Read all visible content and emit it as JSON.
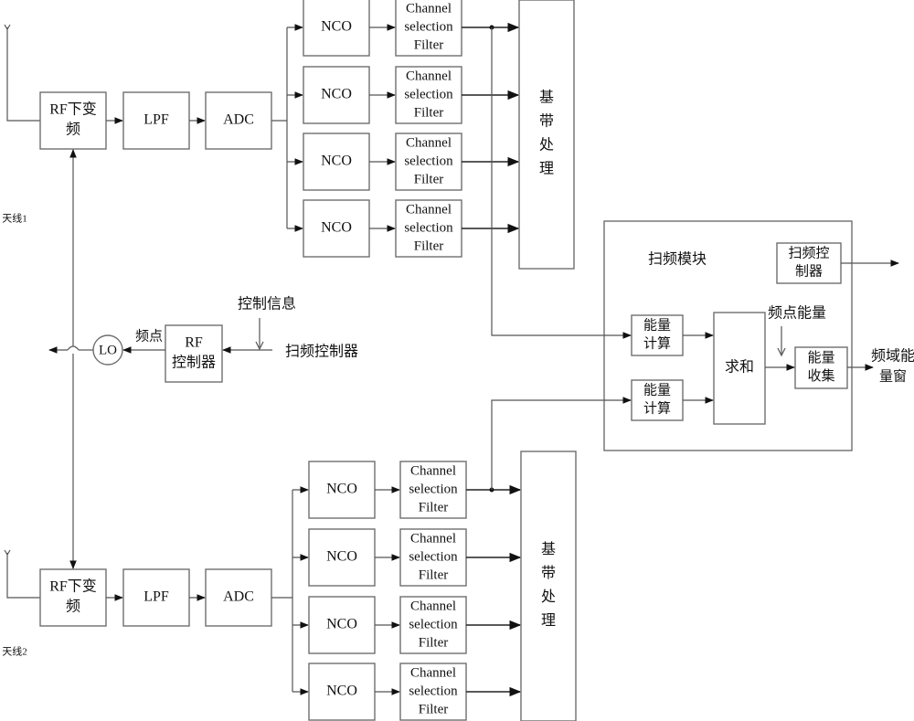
{
  "antennas": [
    {
      "label": "天线1"
    },
    {
      "label": "天线2"
    }
  ],
  "rf_downconvert": [
    "RF下变",
    "频"
  ],
  "lpf": "LPF",
  "adc": "ADC",
  "nco": "NCO",
  "filter": [
    "Channel",
    "selection",
    "Filter"
  ],
  "baseband": [
    "基",
    "带",
    "处",
    "理"
  ],
  "lo": "LO",
  "rf_controller": [
    "RF",
    "控制器"
  ],
  "freq_point_label": "频点",
  "control_info_label": "控制信息",
  "sweep_controller_label": "扫频控制器",
  "sweep_module": {
    "title": "扫频模块",
    "sweep_controller": [
      "扫频控",
      "制器"
    ],
    "energy_calc": [
      "能量",
      "计算"
    ],
    "sum": "求和",
    "freq_point_energy": "频点能量",
    "energy_collect": [
      "能量",
      "收集"
    ],
    "output": [
      "频域能",
      "量窗"
    ]
  }
}
